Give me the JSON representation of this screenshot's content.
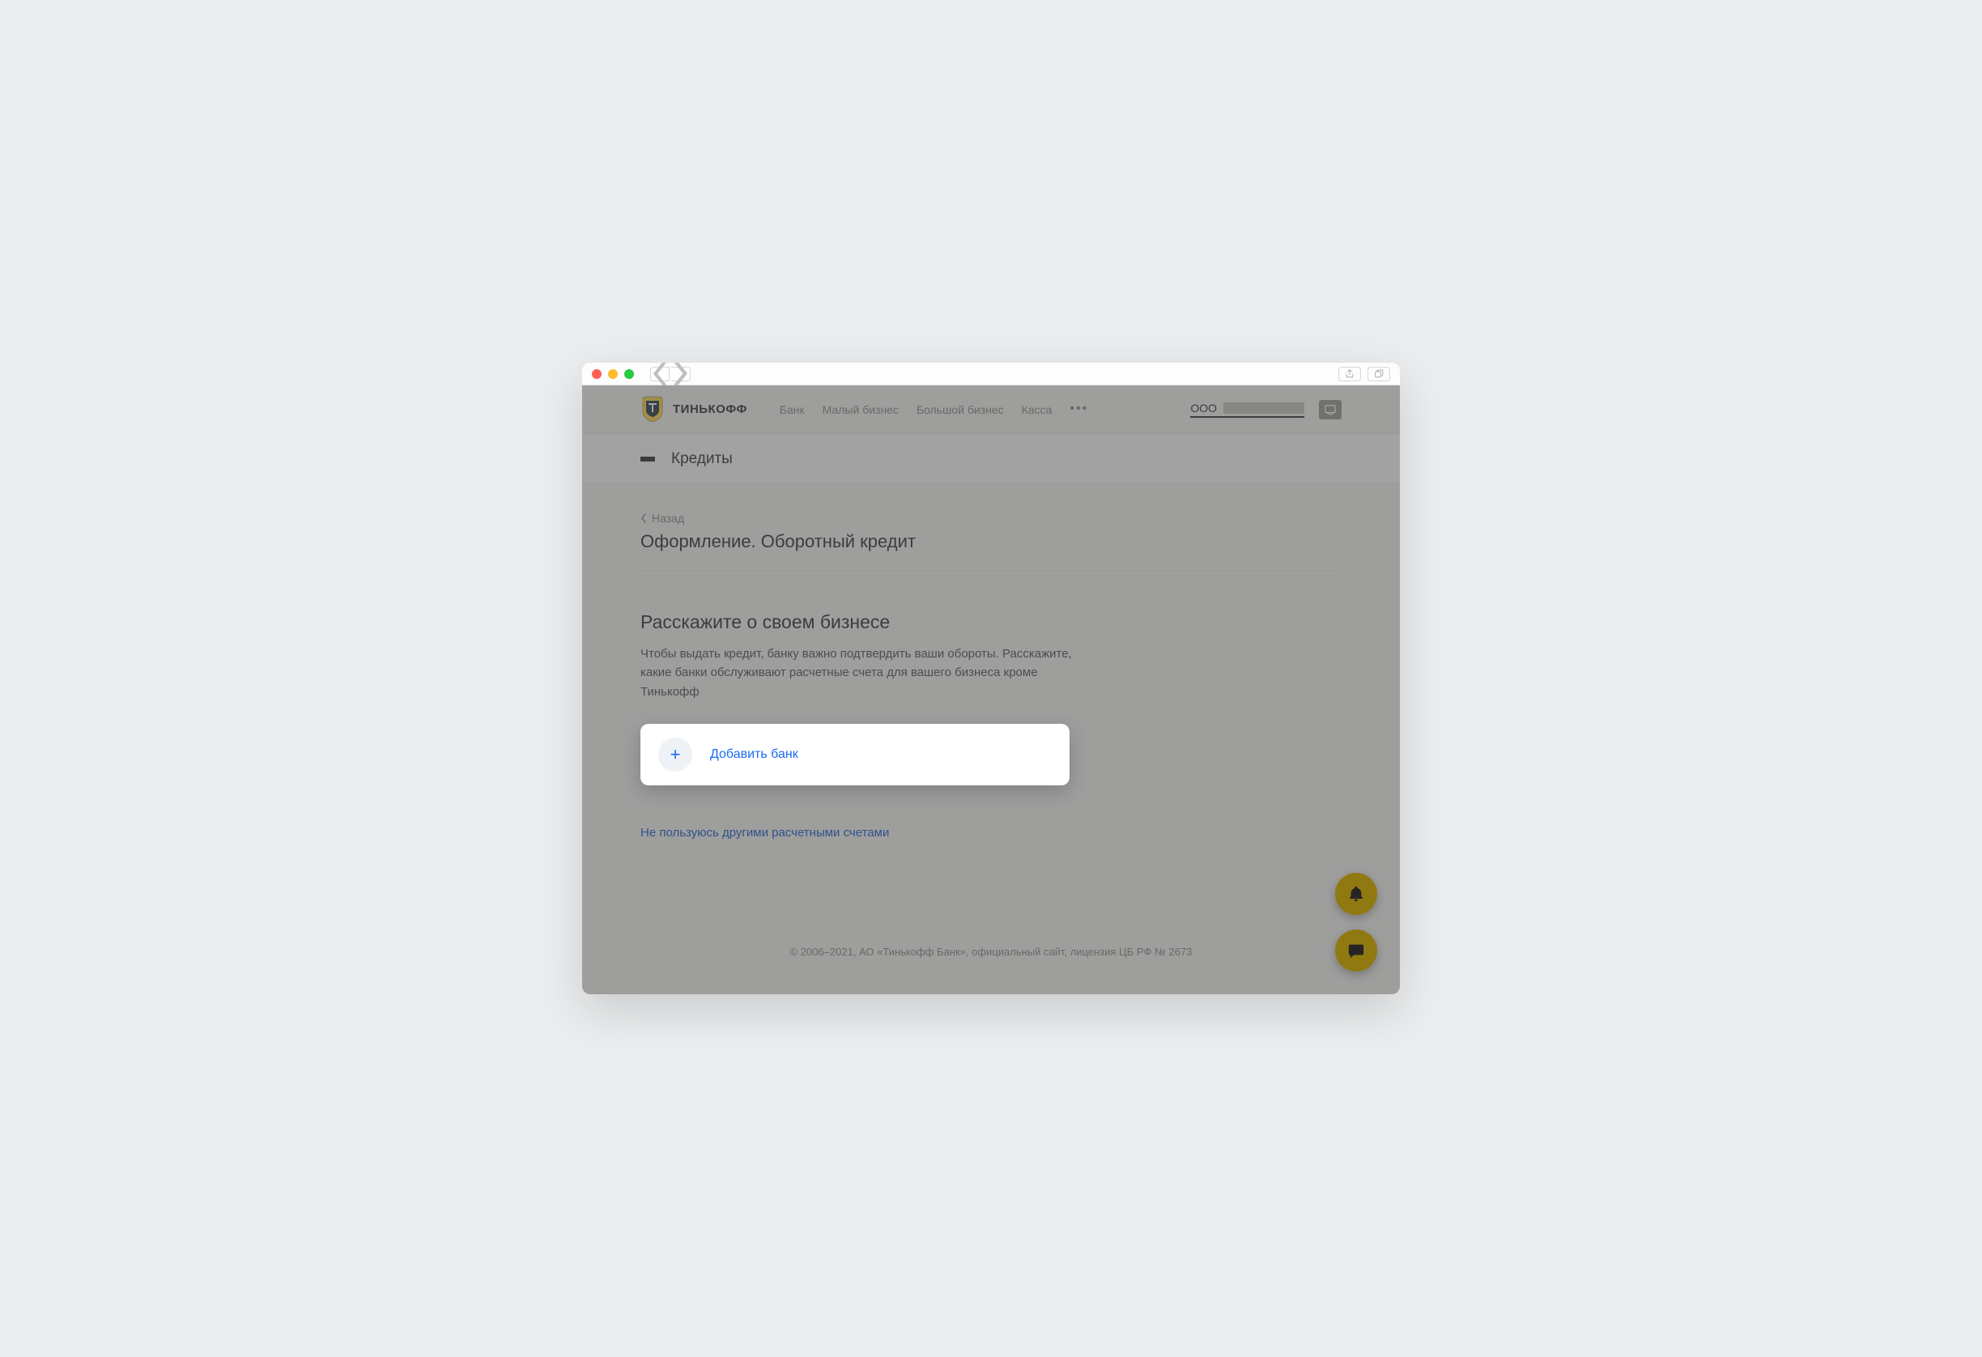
{
  "header": {
    "brand": "ТИНЬКОФФ",
    "nav": [
      "Банк",
      "Малый бизнес",
      "Большой бизнес",
      "Касса"
    ],
    "company_prefix": "ООО"
  },
  "subbar": {
    "title": "Кредиты"
  },
  "page": {
    "back": "Назад",
    "title": "Оформление. Оборотный кредит",
    "section_title": "Расскажите о своем бизнесе",
    "section_desc": "Чтобы выдать кредит, банку важно подтвердить ваши обороты. Расскажите, какие банки обслуживают расчетные счета для вашего бизнеса кроме Тинькофф",
    "add_bank_label": "Добавить банк",
    "secondary_link": "Не пользуюсь другими расчетными счетами"
  },
  "footer": "© 2006–2021, АО «Тинькофф Банк», официальный сайт, лицензия ЦБ РФ № 2673",
  "colors": {
    "accent_blue": "#1a6cf0",
    "brand_yellow": "#c9a818"
  }
}
